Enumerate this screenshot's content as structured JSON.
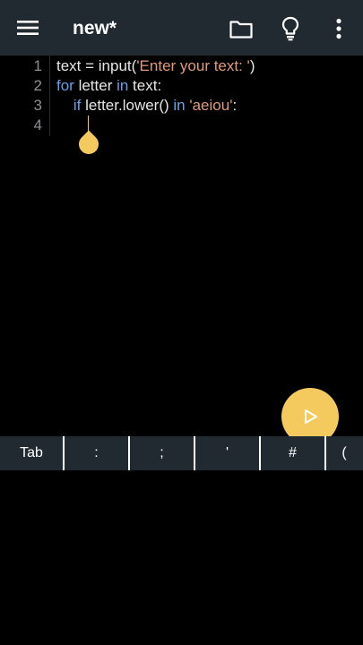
{
  "appbar": {
    "title": "new*",
    "icons": [
      "menu-icon",
      "folder-icon",
      "lightbulb-icon",
      "more-vert-icon"
    ]
  },
  "editor": {
    "line_numbers": [
      "1",
      "2",
      "3",
      "4"
    ],
    "lines": [
      {
        "tokens": [
          {
            "t": "txt",
            "v": "text = input("
          },
          {
            "t": "str",
            "v": "'Enter your text: '"
          },
          {
            "t": "txt",
            "v": ")"
          }
        ]
      },
      {
        "tokens": [
          {
            "t": "kw",
            "v": "for"
          },
          {
            "t": "txt",
            "v": " letter "
          },
          {
            "t": "kw",
            "v": "in"
          },
          {
            "t": "txt",
            "v": " text:"
          }
        ]
      },
      {
        "tokens": [
          {
            "t": "txt",
            "v": "    "
          },
          {
            "t": "kw",
            "v": "if"
          },
          {
            "t": "txt",
            "v": " letter.lower() "
          },
          {
            "t": "kw",
            "v": "in"
          },
          {
            "t": "txt",
            "v": " "
          },
          {
            "t": "str",
            "v": "'aeiou'"
          },
          {
            "t": "txt",
            "v": ":"
          }
        ]
      },
      {
        "tokens": []
      }
    ]
  },
  "symbols": [
    "Tab",
    ":",
    ";",
    "'",
    "#",
    "("
  ],
  "colors": {
    "appbar_bg": "#212931",
    "accent": "#f4c95d",
    "keyword": "#6b9fe8",
    "string": "#e09a7a"
  }
}
